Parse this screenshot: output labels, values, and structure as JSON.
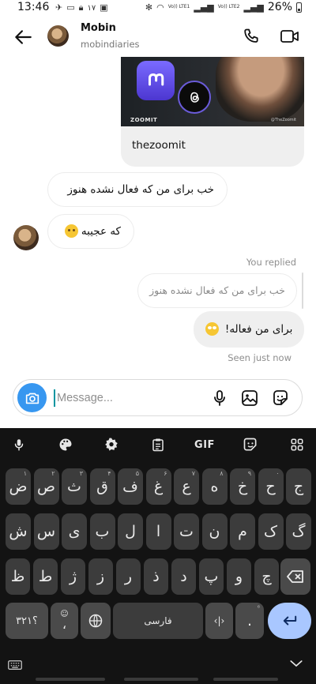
{
  "status_bar": {
    "time": "13:46",
    "notif_count": "۱۷",
    "battery": "26%",
    "signal_labels": [
      "Vo)) LTE1",
      "Vo)) LTE2"
    ]
  },
  "header": {
    "name": "Mobin",
    "username": "mobindiaries"
  },
  "shared_post": {
    "title": "thezoomit",
    "brand": "ZOOMIT",
    "handle": "@TheZoomit"
  },
  "messages": {
    "incoming": [
      {
        "text": "خب برای من که فعال نشده هنوز"
      },
      {
        "text": "که عجیبه"
      }
    ],
    "reply_label": "You replied",
    "quoted": "خب برای من که فعال نشده هنوز",
    "outgoing": "برای من فعاله!",
    "seen": "Seen just now"
  },
  "composer": {
    "placeholder": "Message..."
  },
  "keyboard": {
    "toolbar": {
      "gif": "GIF"
    },
    "row1": [
      {
        "ch": "ض",
        "hint": "۱"
      },
      {
        "ch": "ص",
        "hint": "۲"
      },
      {
        "ch": "ث",
        "hint": "۳"
      },
      {
        "ch": "ق",
        "hint": "۴"
      },
      {
        "ch": "ف",
        "hint": "۵"
      },
      {
        "ch": "غ",
        "hint": "۶"
      },
      {
        "ch": "ع",
        "hint": "۷"
      },
      {
        "ch": "ه",
        "hint": "۸"
      },
      {
        "ch": "خ",
        "hint": "۹"
      },
      {
        "ch": "ح",
        "hint": "۰"
      },
      {
        "ch": "ج",
        "hint": ""
      }
    ],
    "row2": [
      "ش",
      "س",
      "ی",
      "ب",
      "ل",
      "ا",
      "ت",
      "ن",
      "م",
      "ک",
      "گ"
    ],
    "row3": [
      "ظ",
      "ط",
      "ژ",
      "ز",
      "ر",
      "ذ",
      "د",
      "پ",
      "و",
      "چ"
    ],
    "numbers_key": "؟۳۲۱",
    "comma_key": "،",
    "space_label": "فارسی",
    "period_key": "."
  },
  "colors": {
    "accent_blue": "#3797f0",
    "keyboard_bg": "#131313",
    "key_bg": "#3c3c3c",
    "enter_bg": "#a9c7ff"
  }
}
